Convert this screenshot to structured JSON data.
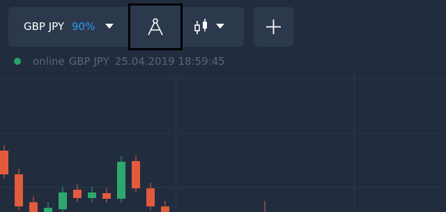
{
  "toolbar": {
    "asset_name": "GBP JPY",
    "payout": "90%",
    "icons": {
      "asset_dropdown": "chevron-down-icon",
      "drawing_tools": "compass-icon",
      "chart_type": "candlestick-icon",
      "chart_type_dropdown": "chevron-down-icon",
      "add_chart": "plus-icon"
    }
  },
  "status": {
    "state": "online",
    "pair": "GBP JPY",
    "datetime": "25.04.2019 18:59:45"
  },
  "colors": {
    "background": "#212d3e",
    "panel": "#2c394d",
    "payout": "#2d9bf0",
    "status_text": "#56667c",
    "online_dot": "#27a464",
    "candle_up": "#2fa86e",
    "candle_down": "#e25b3d",
    "highlight_border": "#000000"
  },
  "chart": {
    "candles": [
      {
        "dir": "down",
        "open": 216,
        "close": 250
      },
      {
        "dir": "down",
        "open": 250,
        "close": 296
      },
      {
        "dir": "down",
        "open": 290,
        "close": 304
      },
      {
        "dir": "up",
        "open": 304,
        "close": 298
      },
      {
        "dir": "up",
        "open": 300,
        "close": 276
      },
      {
        "dir": "down",
        "open": 272,
        "close": 284
      },
      {
        "dir": "up",
        "open": 284,
        "close": 276
      },
      {
        "dir": "down",
        "open": 277,
        "close": 285
      },
      {
        "dir": "up",
        "open": 285,
        "close": 232
      },
      {
        "dir": "down",
        "open": 231,
        "close": 270
      },
      {
        "dir": "down",
        "open": 270,
        "close": 296
      },
      {
        "dir": "down",
        "open": 296,
        "close": 304
      }
    ]
  }
}
